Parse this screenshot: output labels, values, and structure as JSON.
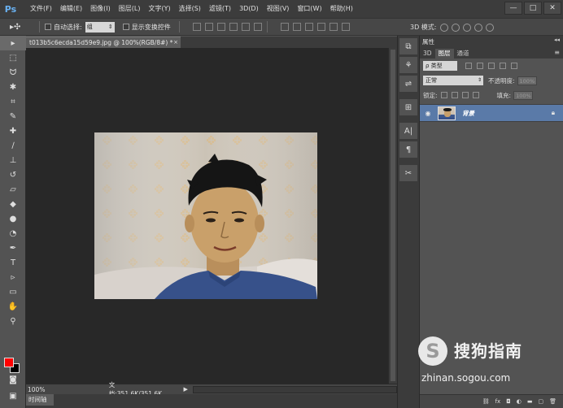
{
  "app": {
    "logo": "Ps"
  },
  "menu": [
    "文件(F)",
    "编辑(E)",
    "图像(I)",
    "图层(L)",
    "文字(Y)",
    "选择(S)",
    "滤镜(T)",
    "3D(D)",
    "视图(V)",
    "窗口(W)",
    "帮助(H)"
  ],
  "window_controls": {
    "minimize": "—",
    "maximize": "□",
    "close": "✕"
  },
  "options": {
    "auto_select_label": "自动选择:",
    "auto_select_value": "组",
    "show_transform_label": "显示变换控件",
    "mode3d_label": "3D 模式:"
  },
  "document": {
    "tab_title": "t013b5c6ecda15d59e9.jpg @ 100%(RGB/8#) *",
    "tab_close": "×",
    "zoom": "100%",
    "doc_info": "文档:351.6K/351.6K",
    "timeline_tab": "时间轴"
  },
  "panels": {
    "properties_title": "属性",
    "tabs": [
      "3D",
      "图层",
      "通道"
    ],
    "active_tab": 1,
    "filter_kind": "ρ 类型",
    "blend_mode": "正常",
    "opacity_label": "不透明度:",
    "opacity_value": "100%",
    "lock_label": "锁定:",
    "fill_label": "填充:",
    "fill_value": "100%",
    "layer_name": "背景"
  },
  "watermark": {
    "title": "搜狗指南",
    "url": "zhinan.sogou.com"
  },
  "colors": {
    "foreground": "#ff0000",
    "background": "#000000",
    "selected_layer": "#5a7aa8",
    "canvas_bg": "#282828"
  }
}
